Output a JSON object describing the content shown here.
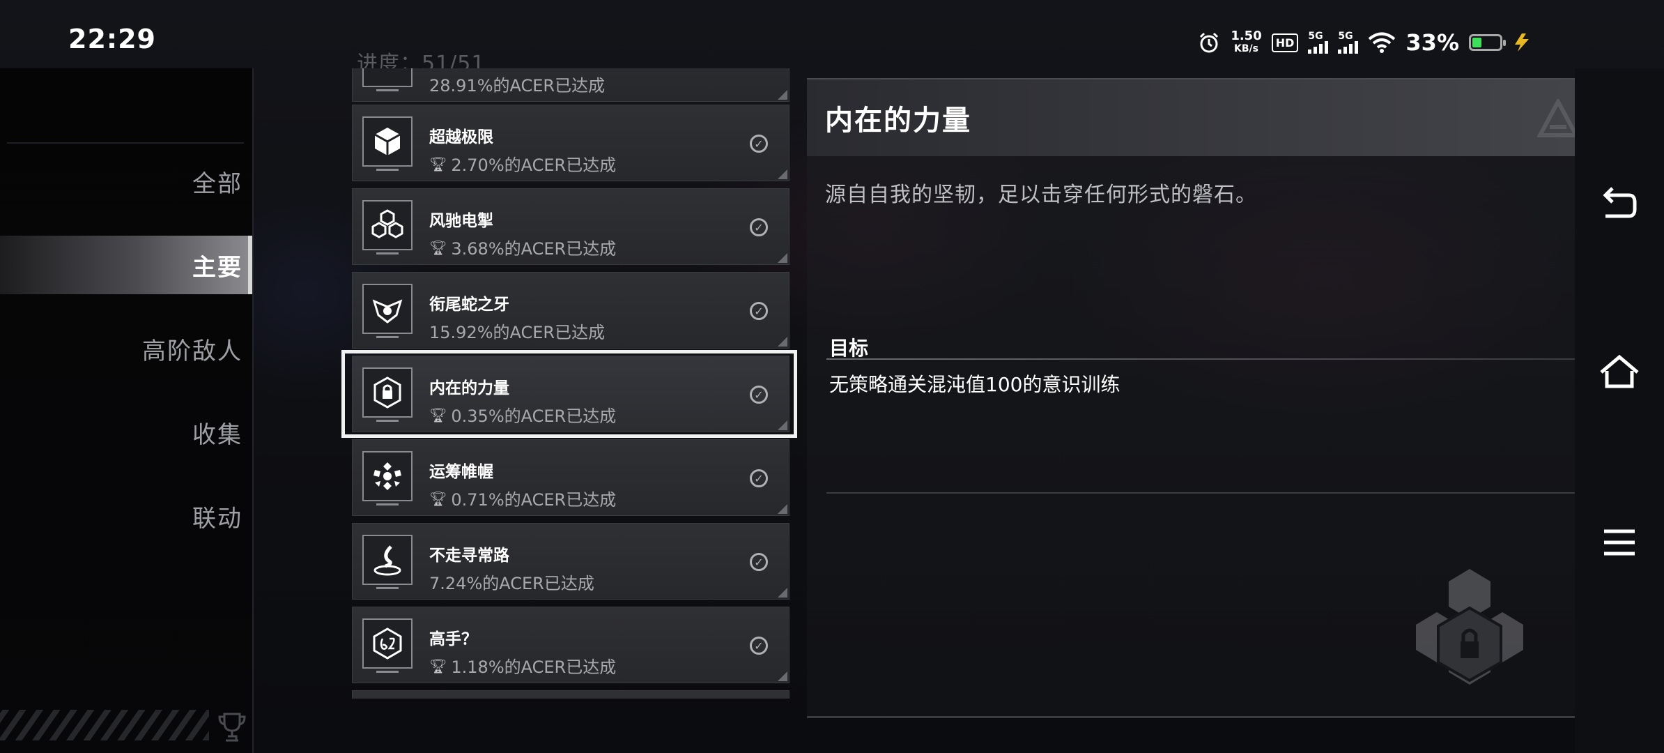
{
  "status_bar": {
    "time": "22:29",
    "net_speed_value": "1.50",
    "net_speed_unit": "KB/s",
    "hd_label": "HD",
    "sim1_label": "5G",
    "sim2_label": "5G",
    "battery_percent": "33%",
    "battery_level": 0.33,
    "battery_color": "#3ee05b"
  },
  "progress": {
    "label": "进度：51/51"
  },
  "sidebar": {
    "items": [
      {
        "label": "全部",
        "active": false
      },
      {
        "label": "主要",
        "active": true
      },
      {
        "label": "高阶敌人",
        "active": false
      },
      {
        "label": "收集",
        "active": false
      },
      {
        "label": "联动",
        "active": false
      }
    ]
  },
  "achievements": [
    {
      "title": "",
      "rate": "28.91%的ACER已达成",
      "trophy": false,
      "icon": "partial-icon"
    },
    {
      "title": "超越极限",
      "rate": "2.70%的ACER已达成",
      "trophy": true,
      "icon": "cube-icon"
    },
    {
      "title": "风驰电掣",
      "rate": "3.68%的ACER已达成",
      "trophy": true,
      "icon": "cube-cluster-icon"
    },
    {
      "title": "衔尾蛇之牙",
      "rate": "15.92%的ACER已达成",
      "trophy": false,
      "icon": "serpent-icon"
    },
    {
      "title": "内在的力量",
      "rate": "0.35%的ACER已达成",
      "trophy": true,
      "icon": "hex-lock-icon",
      "selected": true
    },
    {
      "title": "运筹帷幄",
      "rate": "0.71%的ACER已达成",
      "trophy": true,
      "icon": "hex-flower-icon"
    },
    {
      "title": "不走寻常路",
      "rate": "7.24%的ACER已达成",
      "trophy": false,
      "icon": "vortex-icon"
    },
    {
      "title": "高手？",
      "rate": "1.18%的ACER已达成",
      "trophy": true,
      "icon": "sixty-two-icon"
    }
  ],
  "detail": {
    "title": "内在的力量",
    "description": "源自自我的坚韧，足以击穿任何形式的磐石。",
    "goal_label": "目标",
    "goal_text": "无策略通关混沌值100的意识训练"
  },
  "icons": {
    "back": "back-icon",
    "home": "home-icon",
    "menu": "menu-icon",
    "trophy": "trophy-icon",
    "check": "check-circle-icon"
  },
  "colors": {
    "accent": "#f1f1f1",
    "card_bg": "#2c2d31",
    "battery_green": "#3ee05b"
  }
}
